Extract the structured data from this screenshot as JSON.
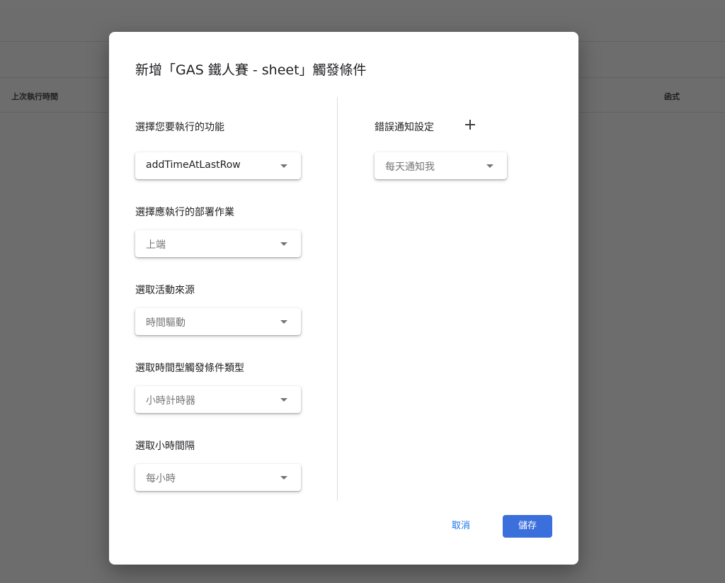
{
  "background": {
    "table_headers": {
      "last_run": "上次執行時間",
      "function": "函式"
    }
  },
  "dialog": {
    "title": "新增「GAS 鐵人賽 - sheet」觸發條件",
    "fields": [
      {
        "label": "選擇您要執行的功能",
        "value": "addTimeAtLastRow"
      },
      {
        "label": "選擇應執行的部署作業",
        "value": "上端"
      },
      {
        "label": "選取活動來源",
        "value": "時間驅動"
      },
      {
        "label": "選取時間型觸發條件類型",
        "value": "小時計時器"
      },
      {
        "label": "選取小時間隔",
        "value": "每小時"
      }
    ],
    "error_notification": {
      "label": "錯誤通知設定",
      "value": "每天通知我"
    },
    "buttons": {
      "cancel": "取消",
      "save": "儲存"
    }
  },
  "colors": {
    "primary_button": "#3b6fdc",
    "link": "#1a73e8",
    "overlay": "#6d6d6d"
  },
  "icons": {
    "add": "plus-icon",
    "dropdown": "chevron-down-icon"
  }
}
